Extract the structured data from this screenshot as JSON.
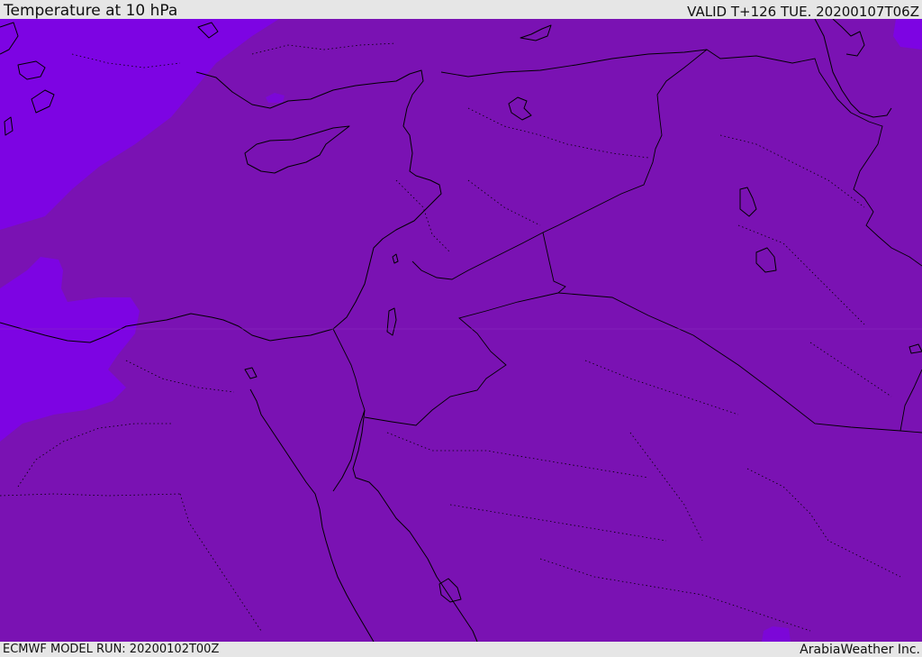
{
  "header": {
    "title": "Temperature at 10 hPa",
    "valid": "VALID T+126 TUE. 20200107T06Z"
  },
  "footer": {
    "model_run": "ECMWF MODEL RUN: 20200102T00Z",
    "credit": "ArabiaWeather Inc."
  },
  "map": {
    "field_colors": {
      "background": "#7a12b3",
      "cold_patch": "#7d04e3",
      "mid_patch": "#7c07d8"
    },
    "boundary_color": "#000000"
  }
}
